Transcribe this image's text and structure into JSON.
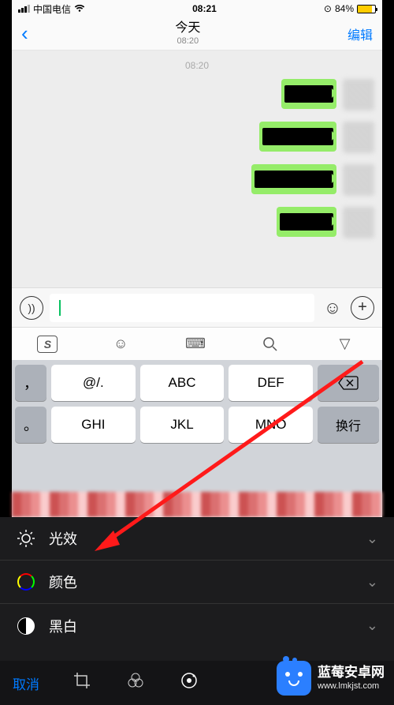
{
  "status": {
    "carrier": "中国电信",
    "time": "08:21",
    "battery_pct": "84%"
  },
  "nav": {
    "title": "今天",
    "subtitle": "08:20",
    "edit": "编辑"
  },
  "chat": {
    "timestamp": "08:20"
  },
  "keyboard": {
    "toolbar_sogou": "S",
    "r1": {
      "side": "，",
      "k1": "@/.",
      "k2": "ABC",
      "k3": "DEF"
    },
    "r2": {
      "side": "。",
      "k1": "GHI",
      "k2": "JKL",
      "k3": "MNO",
      "action": "换行"
    }
  },
  "edit_panel": {
    "light": "光效",
    "color": "颜色",
    "bw": "黑白",
    "cancel": "取消"
  },
  "watermark": {
    "title": "蓝莓安卓网",
    "url": "www.lmkjst.com"
  }
}
